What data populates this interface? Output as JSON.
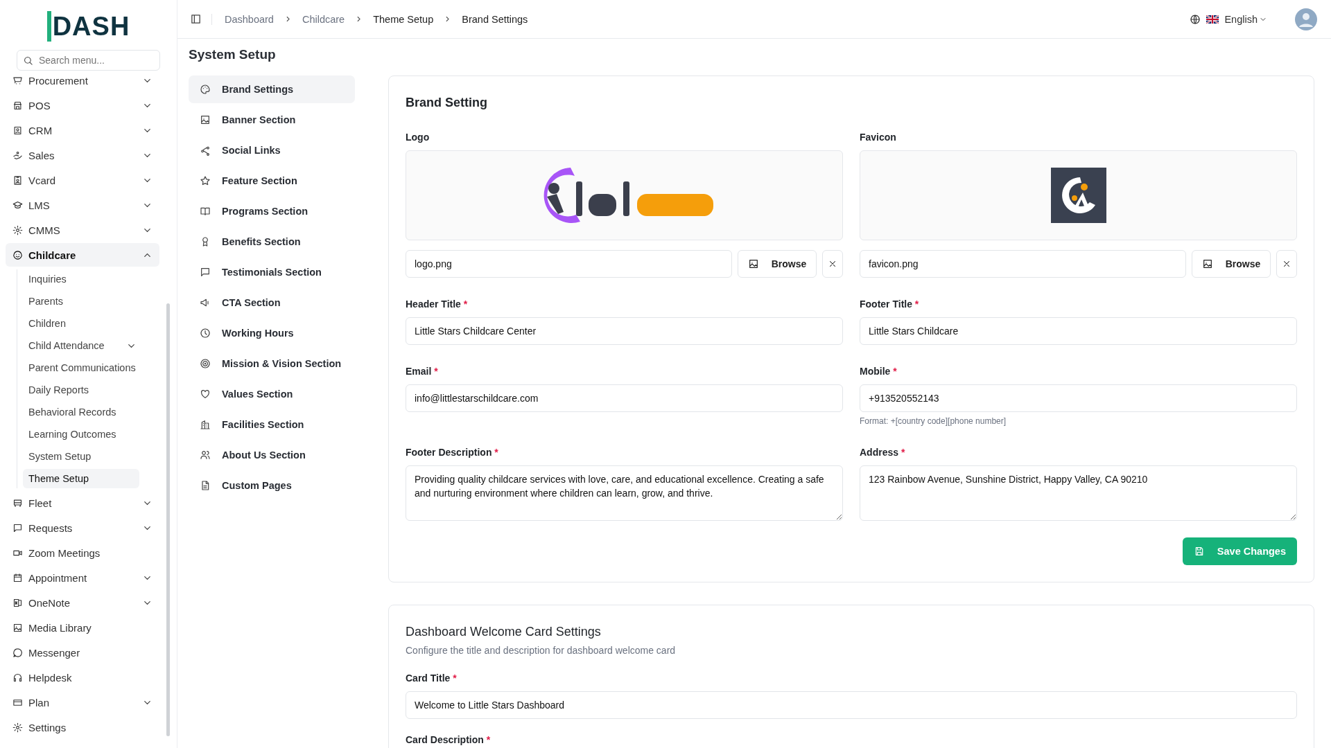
{
  "brand": {
    "logo": "DASH"
  },
  "sidebar": {
    "search_placeholder": "Search menu...",
    "items": [
      {
        "label": "Procurement",
        "has_submenu": true,
        "expanded": false,
        "selected": false
      },
      {
        "label": "POS",
        "has_submenu": true,
        "expanded": false,
        "selected": false
      },
      {
        "label": "CRM",
        "has_submenu": true,
        "expanded": false,
        "selected": false
      },
      {
        "label": "Sales",
        "has_submenu": true,
        "expanded": false,
        "selected": false
      },
      {
        "label": "Vcard",
        "has_submenu": true,
        "expanded": false,
        "selected": false
      },
      {
        "label": "LMS",
        "has_submenu": true,
        "expanded": false,
        "selected": false
      },
      {
        "label": "CMMS",
        "has_submenu": true,
        "expanded": false,
        "selected": false
      },
      {
        "label": "Childcare",
        "has_submenu": true,
        "expanded": true,
        "selected": true,
        "children": [
          {
            "label": "Inquiries",
            "has_submenu": false,
            "selected": false
          },
          {
            "label": "Parents",
            "has_submenu": false,
            "selected": false
          },
          {
            "label": "Children",
            "has_submenu": false,
            "selected": false
          },
          {
            "label": "Child Attendance",
            "has_submenu": true,
            "selected": false
          },
          {
            "label": "Parent Communications",
            "has_submenu": false,
            "selected": false
          },
          {
            "label": "Daily Reports",
            "has_submenu": false,
            "selected": false
          },
          {
            "label": "Behavioral Records",
            "has_submenu": false,
            "selected": false
          },
          {
            "label": "Learning Outcomes",
            "has_submenu": false,
            "selected": false
          },
          {
            "label": "System Setup",
            "has_submenu": false,
            "selected": false
          },
          {
            "label": "Theme Setup",
            "has_submenu": false,
            "selected": true
          }
        ]
      },
      {
        "label": "Fleet",
        "has_submenu": true,
        "expanded": false,
        "selected": false
      },
      {
        "label": "Requests",
        "has_submenu": true,
        "expanded": false,
        "selected": false
      },
      {
        "label": "Zoom Meetings",
        "has_submenu": false,
        "selected": false
      },
      {
        "label": "Appointment",
        "has_submenu": true,
        "expanded": false,
        "selected": false
      },
      {
        "label": "OneNote",
        "has_submenu": true,
        "expanded": false,
        "selected": false
      },
      {
        "label": "Media Library",
        "has_submenu": false,
        "selected": false
      },
      {
        "label": "Messenger",
        "has_submenu": false,
        "selected": false
      },
      {
        "label": "Helpdesk",
        "has_submenu": false,
        "selected": false
      },
      {
        "label": "Plan",
        "has_submenu": true,
        "expanded": false,
        "selected": false
      },
      {
        "label": "Settings",
        "has_submenu": false,
        "selected": false
      }
    ]
  },
  "breadcrumb": [
    {
      "label": "Dashboard",
      "muted": true
    },
    {
      "label": "Childcare",
      "muted": true
    },
    {
      "label": "Theme Setup",
      "muted": false
    },
    {
      "label": "Brand Settings",
      "muted": false
    }
  ],
  "language": "English",
  "page_title": "System Setup",
  "settings_nav": [
    {
      "label": "Brand Settings",
      "selected": true
    },
    {
      "label": "Banner Section",
      "selected": false
    },
    {
      "label": "Social Links",
      "selected": false
    },
    {
      "label": "Feature Section",
      "selected": false
    },
    {
      "label": "Programs Section",
      "selected": false
    },
    {
      "label": "Benefits Section",
      "selected": false
    },
    {
      "label": "Testimonials Section",
      "selected": false
    },
    {
      "label": "CTA Section",
      "selected": false
    },
    {
      "label": "Working Hours",
      "selected": false
    },
    {
      "label": "Mission & Vision Section",
      "selected": false
    },
    {
      "label": "Values Section",
      "selected": false
    },
    {
      "label": "Facilities Section",
      "selected": false
    },
    {
      "label": "About Us Section",
      "selected": false
    },
    {
      "label": "Custom Pages",
      "selected": false
    }
  ],
  "brand_setting": {
    "title": "Brand Setting",
    "uploads": [
      {
        "label": "Logo",
        "kind": "picture",
        "file": "logo.png",
        "button": "Browse"
      },
      {
        "label": "Favicon",
        "kind": "picture",
        "file": "favicon.png",
        "button": "Browse"
      }
    ],
    "fields": [
      {
        "label": "Header Title",
        "required_mark": "*",
        "kind": "input",
        "value": "Little Stars Childcare Center"
      },
      {
        "label": "Footer Title",
        "required_mark": "*",
        "kind": "input",
        "value": "Little Stars Childcare"
      },
      {
        "label": "Email",
        "required_mark": "*",
        "kind": "input",
        "value": "info@littlestarschildcare.com"
      },
      {
        "label": "Mobile",
        "required_mark": "*",
        "kind": "input",
        "value": "+913520552143",
        "hint": "Format: +[country code][phone number]"
      },
      {
        "label": "Footer Description",
        "required_mark": "*",
        "kind": "textarea",
        "value": "Providing quality childcare services with love, care, and educational excellence. Creating a safe and nurturing environment where children can learn, grow, and thrive."
      },
      {
        "label": "Address",
        "required_mark": "*",
        "kind": "textarea",
        "value": "123 Rainbow Avenue, Sunshine District, Happy Valley, CA 90210"
      }
    ],
    "save_button": "Save Changes"
  },
  "welcome_card": {
    "title": "Dashboard Welcome Card Settings",
    "subtitle": "Configure the title and description for dashboard welcome card",
    "fields": [
      {
        "label": "Card Title",
        "required_mark": "*",
        "kind": "input",
        "value": "Welcome to Little Stars Dashboard"
      },
      {
        "label": "Card Description",
        "required_mark": "*",
        "kind": "label_only"
      }
    ]
  }
}
